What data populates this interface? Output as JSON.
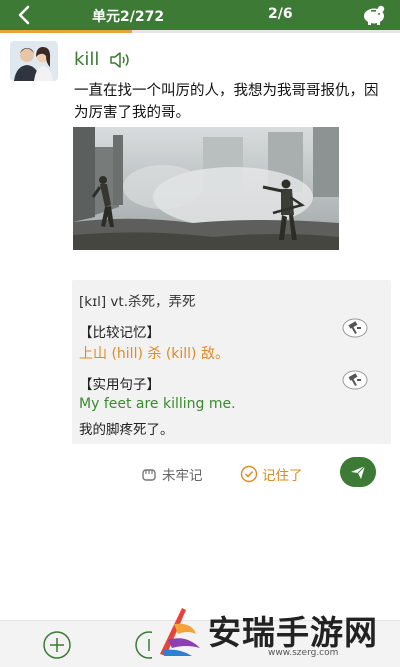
{
  "header": {
    "unit_label": "单元2/272",
    "page_label": "2/6",
    "progress": 0.33
  },
  "word": {
    "text": "kill",
    "sentence": "一直在找一个叫厉的人，我想为我哥哥报仇，因为厉害了我的哥。"
  },
  "definition": {
    "phonetic": "[kɪl] vt.杀死，弄死",
    "compare_title": "【比较记忆】",
    "compare_text": "上山 (hill) 杀 (kill) 敌。",
    "example_title": "【实用句子】",
    "example_en": "My feet are killing me.",
    "example_zh": "我的脚疼死了。"
  },
  "actions": {
    "unsure_label": "未牢记",
    "remember_label": "记住了"
  },
  "watermark": {
    "text": "安瑞手游网",
    "url": "www.szerg.com"
  },
  "colors": {
    "primary": "#3d7a35",
    "accent": "#e08a23",
    "example_green": "#3a8a2e"
  },
  "icons": [
    "back-icon",
    "piggy-bank-icon",
    "speaker-icon",
    "hammer-icon",
    "fist-icon",
    "check-circle-icon",
    "send-icon",
    "plus-circle-icon"
  ]
}
